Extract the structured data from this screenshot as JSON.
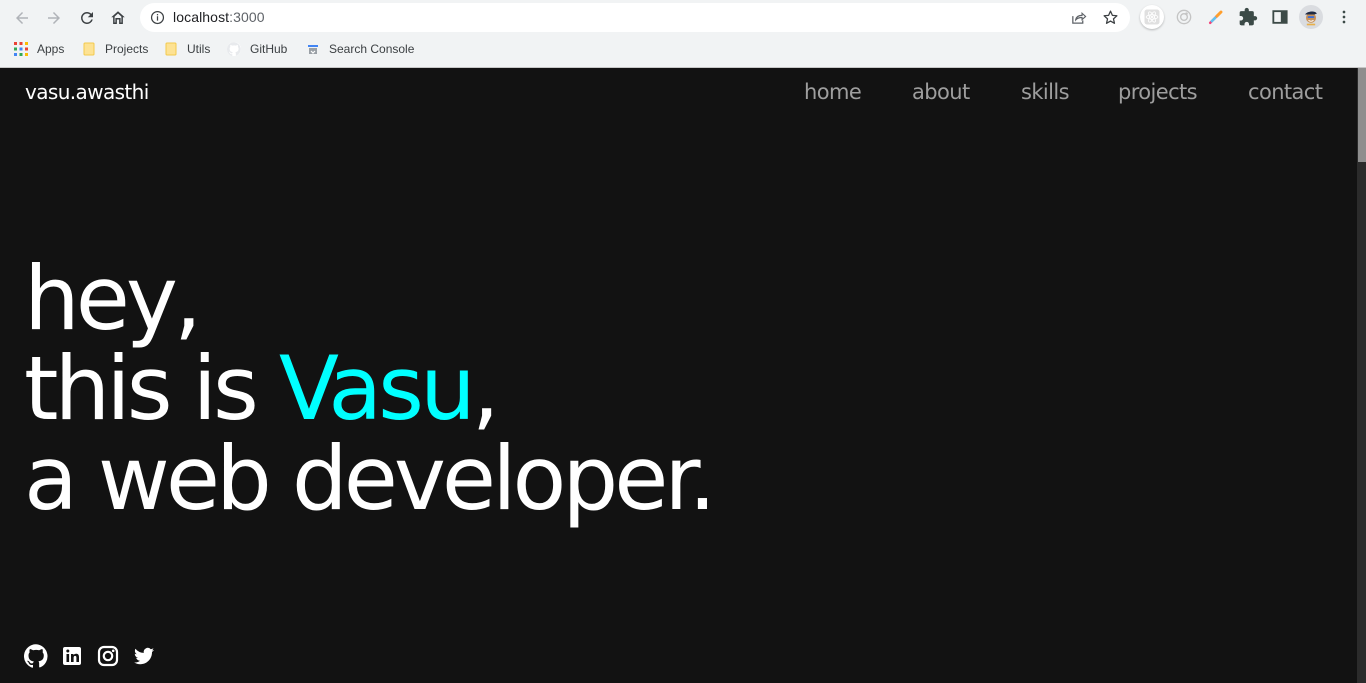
{
  "browser": {
    "url_host": "localhost",
    "url_port": ":3000",
    "bookmarks": [
      {
        "label": "Apps",
        "icon": "apps-grid-icon"
      },
      {
        "label": "Projects",
        "icon": "folder-icon"
      },
      {
        "label": "Utils",
        "icon": "folder-icon"
      },
      {
        "label": "GitHub",
        "icon": "github-icon"
      },
      {
        "label": "Search Console",
        "icon": "search-console-icon"
      }
    ],
    "extensions": [
      "react-devtools-icon",
      "target-extension-icon",
      "color-picker-icon",
      "extensions-puzzle-icon",
      "side-panel-icon",
      "profile-avatar",
      "menu-kebab-icon"
    ]
  },
  "site": {
    "logo": "vasu.awasthi",
    "nav": [
      {
        "label": "home"
      },
      {
        "label": "about"
      },
      {
        "label": "skills"
      },
      {
        "label": "projects"
      },
      {
        "label": "contact"
      }
    ],
    "hero": {
      "line1": "hey,",
      "line2_prefix": "this is ",
      "line2_name": "Vasu",
      "line2_suffix": ",",
      "line3": "a web developer."
    },
    "social": [
      "github",
      "linkedin",
      "instagram",
      "twitter"
    ],
    "colors": {
      "background": "#121212",
      "accent": "#00ffff",
      "text": "#ffffff",
      "nav_text": "#9e9e9e"
    }
  }
}
